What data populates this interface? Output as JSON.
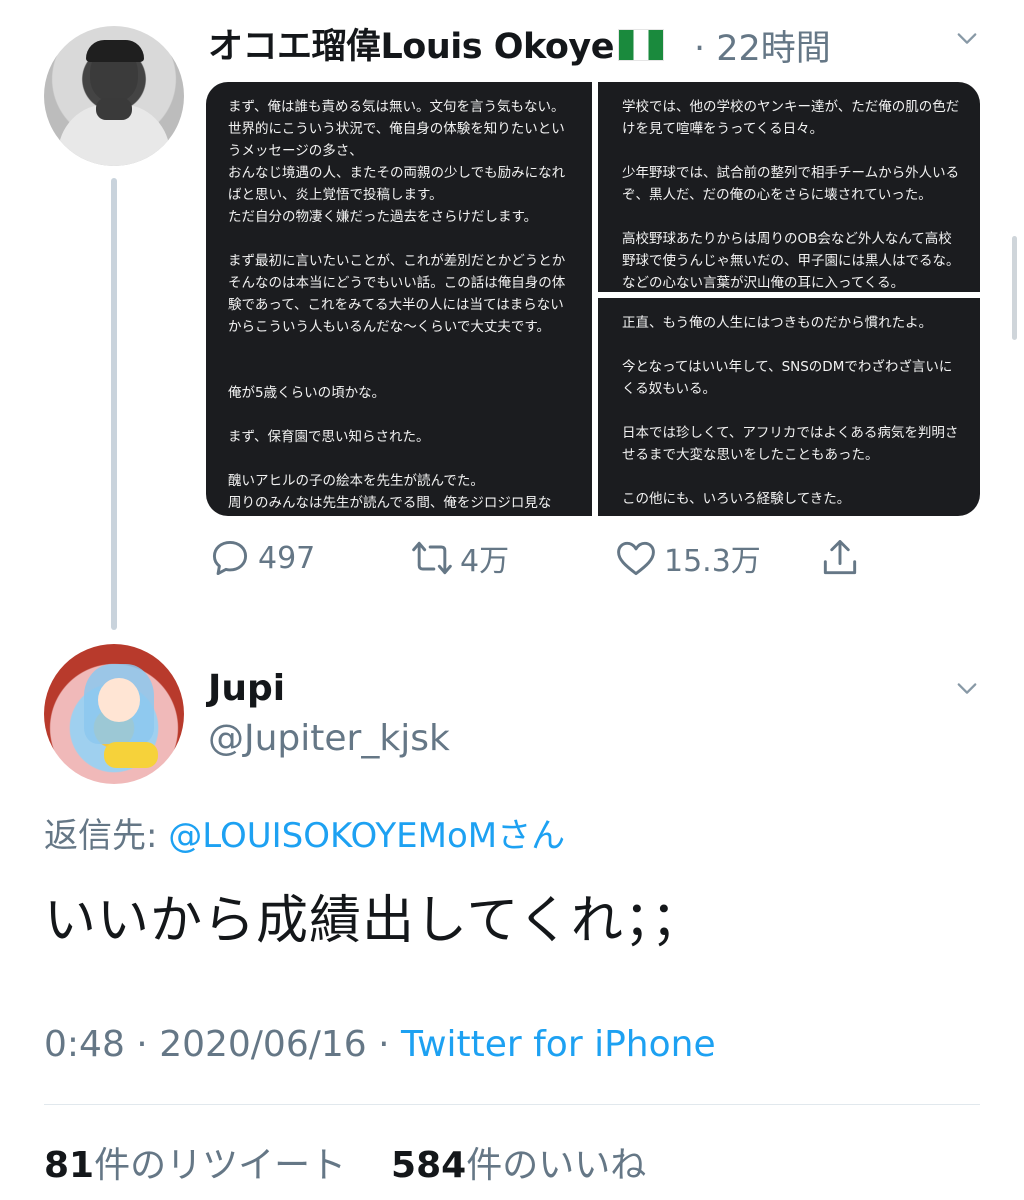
{
  "parent_tweet": {
    "author_name": "オコエ瑠偉Louis Okoye",
    "flag_icon": "nigeria-flag-icon",
    "time": "· 22時間",
    "media": {
      "left_panel": "まず、俺は誰も責める気は無い。文句を言う気もない。世界的にこういう状況で、俺自身の体験を知りたいというメッセージの多さ、\nおんなじ境遇の人、またその両親の少しでも励みになればと思い、炎上覚悟で投稿します。\nただ自分の物凄く嫌だった過去をさらけだします。\n\nまず最初に言いたいことが、これが差別だとかどうとかそんなのは本当にどうでもいい話。この話は俺自身の体験であって、これをみてる大半の人には当てはまらないからこういう人もいるんだな〜くらいで大丈夫です。\n\n\n俺が5歳くらいの頃かな。\n\nまず、保育園で思い知らされた。\n\n醜いアヒルの子の絵本を先生が読んでた。\n周りのみんなは先生が読んでる間、俺をジロジロ見な",
      "right_top_panel": "学校では、他の学校のヤンキー達が、ただ俺の肌の色だけを見て喧嘩をうってくる日々。\n\n少年野球では、試合前の整列で相手チームから外人いるぞ、黒人だ、だの俺の心をさらに壊されていった。\n\n高校野球あたりからは周りのOB会など外人なんて高校野球で使うんじゃ無いだの、甲子園には黒人はでるな。などの心ない言葉が沢山俺の耳に入ってくる。",
      "right_bottom_panel": "正直、もう俺の人生にはつきものだから慣れたよ。\n\n今となってはいい年して、SNSのDMでわざわざ言いにくる奴もいる。\n\n日本では珍しくて、アフリカではよくある病気を判明させるまで大変な思いをしたこともあった。\n\nこの他にも、いろいろ経験してきた。"
    },
    "actions": {
      "reply_count": "497",
      "retweet_count": "4万",
      "like_count": "15.3万"
    }
  },
  "reply_tweet": {
    "author_name": "Jupi",
    "handle": "@Jupiter_kjsk",
    "reply_to_label": "返信先: ",
    "reply_to_handle": "@LOUISOKOYEMoMさん",
    "text": "いいから成績出してくれ；；",
    "time": "0:48",
    "date": "2020/06/16",
    "source": "Twitter for iPhone",
    "retweets_count": "81",
    "retweets_label": "件のリツイート",
    "likes_count": "584",
    "likes_label": "件のいいね"
  },
  "colors": {
    "link": "#1da1f2",
    "secondary_text": "#657786",
    "primary_text": "#14171a",
    "thread_line": "#c9d3dc"
  }
}
